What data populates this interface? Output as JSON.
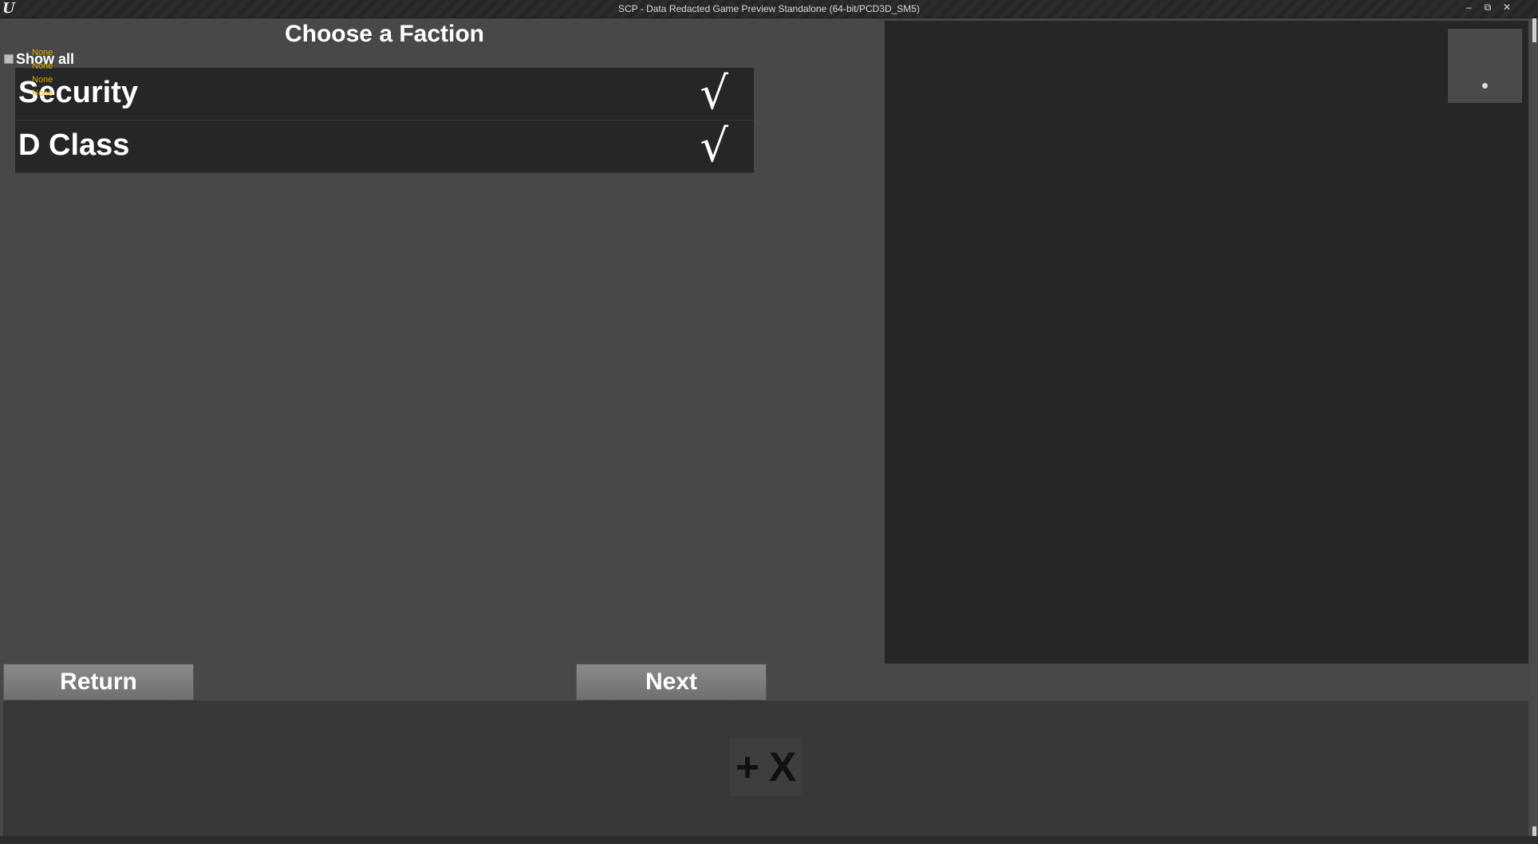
{
  "window": {
    "title": "SCP - Data Redacted Game Preview Standalone (64-bit/PCD3D_SM5)",
    "logo": "U",
    "minimize_glyph": "–",
    "restore_glyph": "⧉",
    "close_glyph": "✕"
  },
  "heading": "Choose a Faction",
  "show_all": {
    "label": "Show all",
    "checked": false
  },
  "debug_lines": [
    "None",
    "None",
    "None",
    "None"
  ],
  "factions": [
    {
      "name": "Security",
      "check": "√",
      "selected": true
    },
    {
      "name": "D Class",
      "check": "√",
      "selected": true
    }
  ],
  "buttons": {
    "return": "Return",
    "next": "Next"
  },
  "tools": {
    "add": "+",
    "remove": "X"
  },
  "colors": {
    "debug_text": "#e0a800",
    "panel": "#262626",
    "background": "#484848"
  }
}
